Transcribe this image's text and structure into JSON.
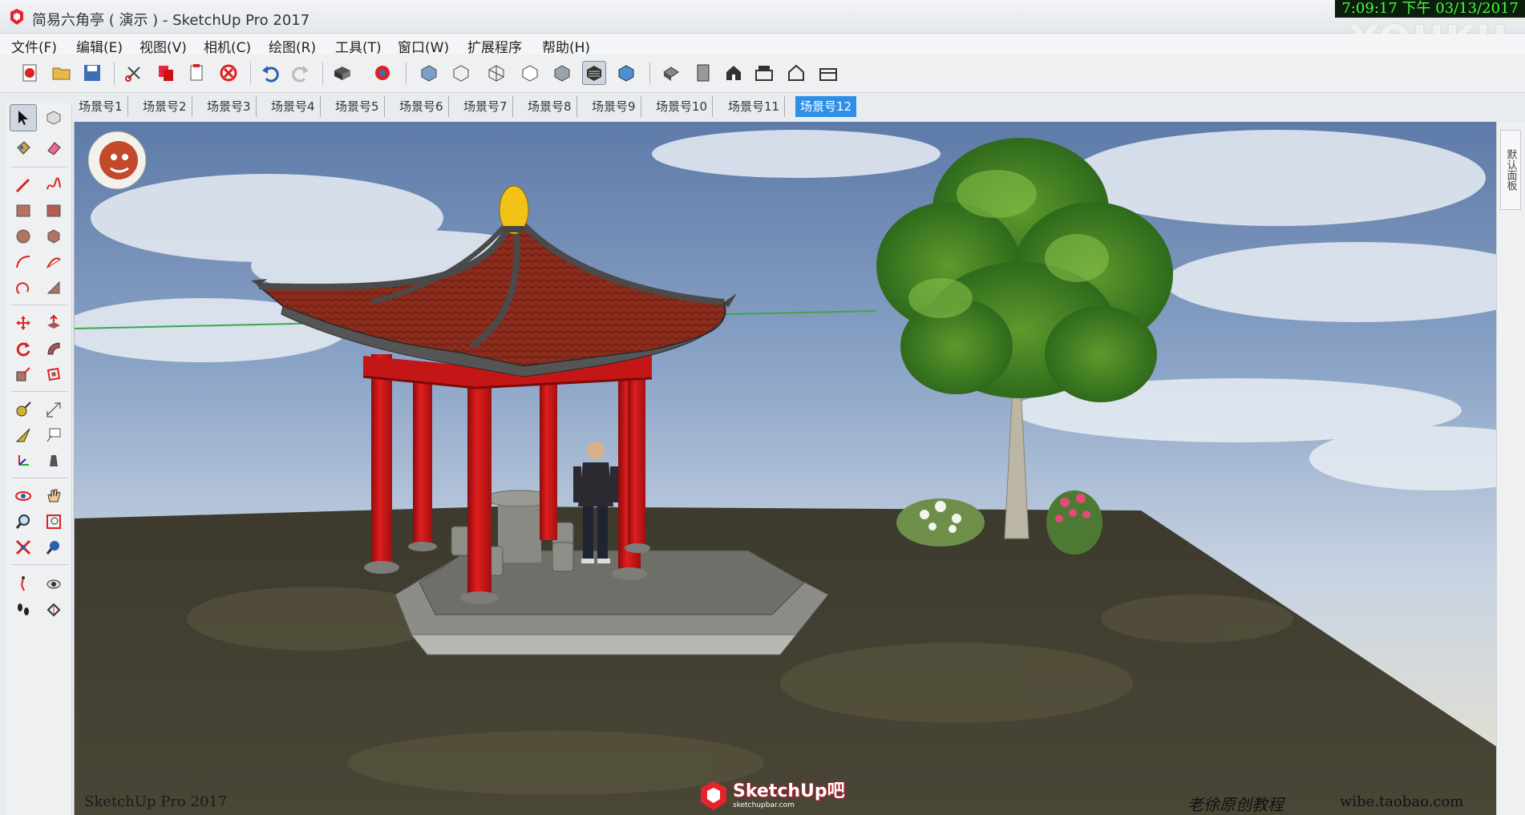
{
  "window": {
    "title": "简易六角亭 ( 演示 ) - SketchUp Pro 2017",
    "clock": "7:09:17 下午 03/13/2017",
    "watermark": "YOUKU"
  },
  "menu": [
    "文件(F)",
    "编辑(E)",
    "视图(V)",
    "相机(C)",
    "绘图(R)",
    "工具(T)",
    "窗口(W)",
    "扩展程序",
    "帮助(H)"
  ],
  "scenes": {
    "tabs": [
      "场景号1",
      "场景号2",
      "场景号3",
      "场景号4",
      "场景号5",
      "场景号6",
      "场景号7",
      "场景号8",
      "场景号9",
      "场景号10",
      "场景号11",
      "场景号12"
    ],
    "active_index": 11
  },
  "right_panel": {
    "tab_label": "默认面板"
  },
  "viewport": {
    "version_watermark": "SketchUp Pro 2017",
    "brand_logo": "SketchUp吧",
    "brand_url_small": "sketchupbar.com",
    "signature": "老徐原创教程",
    "shop_url": "wibe.taobao.com"
  },
  "colors": {
    "accent_tab": "#2e8fe6",
    "pillar_red": "#d21a1a",
    "roof_tile": "#8a2a1a",
    "finial_gold": "#f2c316"
  }
}
